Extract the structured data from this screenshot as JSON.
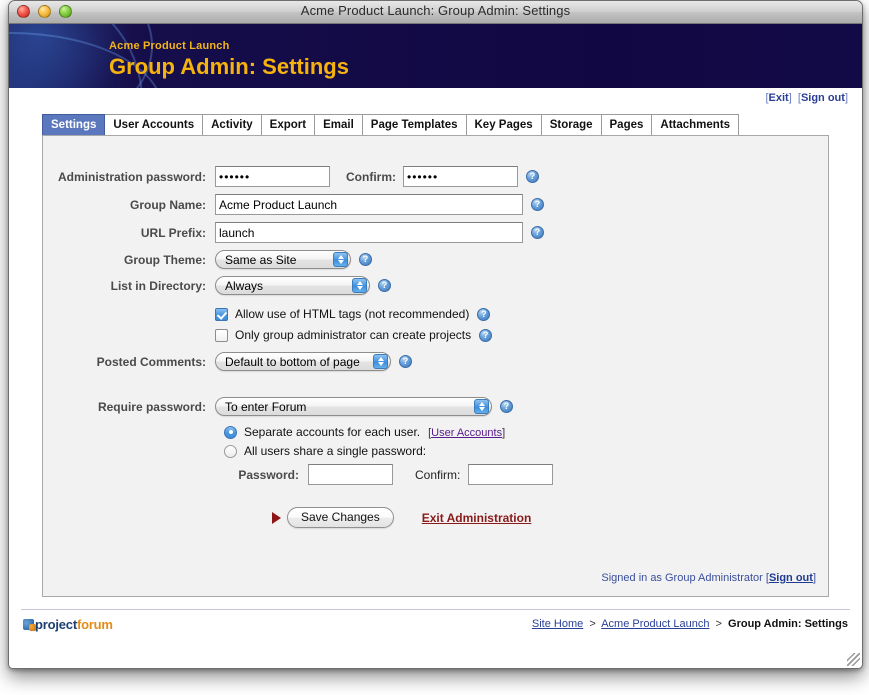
{
  "window": {
    "title": "Acme Product Launch: Group Admin: Settings",
    "controls": {
      "close": "close",
      "minimize": "minimize",
      "zoom": "zoom"
    }
  },
  "banner": {
    "subtitle": "Acme Product Launch",
    "title": "Group Admin: Settings"
  },
  "toplinks": {
    "exit": "Exit",
    "signout": "Sign out",
    "open_bracket": "[",
    "close_bracket": "]"
  },
  "tabs": [
    {
      "label": "Settings",
      "active": true
    },
    {
      "label": "User Accounts",
      "active": false
    },
    {
      "label": "Activity",
      "active": false
    },
    {
      "label": "Export",
      "active": false
    },
    {
      "label": "Email",
      "active": false
    },
    {
      "label": "Page Templates",
      "active": false
    },
    {
      "label": "Key Pages",
      "active": false
    },
    {
      "label": "Storage",
      "active": false
    },
    {
      "label": "Pages",
      "active": false
    },
    {
      "label": "Attachments",
      "active": false
    }
  ],
  "form": {
    "admin_password": {
      "label": "Administration password:",
      "value": "••••••",
      "confirm_label": "Confirm:",
      "confirm_value": "••••••"
    },
    "group_name": {
      "label": "Group Name:",
      "value": "Acme Product Launch"
    },
    "url_prefix": {
      "label": "URL Prefix:",
      "value": "launch"
    },
    "group_theme": {
      "label": "Group Theme:",
      "value": "Same as Site",
      "options": [
        "Same as Site"
      ]
    },
    "list_in_directory": {
      "label": "List in Directory:",
      "value": "Always",
      "options": [
        "Always"
      ]
    },
    "allow_html": {
      "label": "Allow use of HTML tags (not recommended)",
      "checked": true
    },
    "admin_only_projects": {
      "label": "Only group administrator can create projects",
      "checked": false
    },
    "posted_comments": {
      "label": "Posted Comments:",
      "value": "Default to bottom of page",
      "options": [
        "Default to bottom of page"
      ]
    },
    "require_password": {
      "label": "Require password:",
      "value": "To enter Forum",
      "options": [
        "To enter Forum"
      ]
    },
    "account_mode": {
      "separate_label": "Separate accounts for each user.",
      "separate_link": "User Accounts",
      "separate_selected": true,
      "shared_label": "All users share a single password:",
      "shared_selected": false,
      "shared_password_label": "Password:",
      "shared_password_value": "",
      "shared_confirm_label": "Confirm:",
      "shared_confirm_value": ""
    },
    "save_button": "Save Changes",
    "exit_admin_link": "Exit Administration"
  },
  "status": {
    "signed_in_text": "Signed in as Group Administrator",
    "signout_link": "Sign out",
    "open_bracket": "[",
    "close_bracket": "]"
  },
  "footer": {
    "logo_part1": "project",
    "logo_part2": "forum",
    "breadcrumb": {
      "site_home": "Site Home",
      "group": "Acme Product Launch",
      "current": "Group Admin: Settings",
      "separator": ">"
    }
  },
  "colors": {
    "banner_bg": "#120a47",
    "banner_title": "#f6b30e",
    "tab_active_bg": "#5b77bd",
    "link_blue": "#2a3f96",
    "exit_admin_red": "#8a1a1a",
    "panel_bg": "#f2f2f2"
  }
}
